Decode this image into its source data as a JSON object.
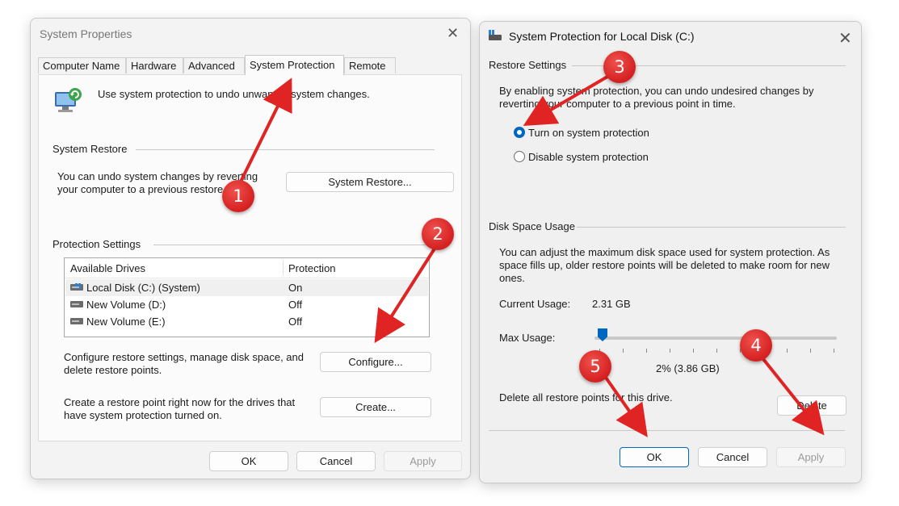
{
  "sysprops": {
    "title": "System Properties",
    "tabs": [
      "Computer Name",
      "Hardware",
      "Advanced",
      "System Protection",
      "Remote"
    ],
    "active_tab": "System Protection",
    "intro_text": "Use system protection to undo unwanted system changes.",
    "restore_group": "System Restore",
    "restore_desc_line1": "You can undo system changes by reverting",
    "restore_desc_line2": "your computer to a previous restore point.",
    "restore_button": "System Restore...",
    "protection_group": "Protection Settings",
    "drives_headers": {
      "drive": "Available Drives",
      "protection": "Protection"
    },
    "drives": [
      {
        "name": "Local Disk (C:) (System)",
        "protection": "On",
        "system": true
      },
      {
        "name": "New Volume (D:)",
        "protection": "Off",
        "system": false
      },
      {
        "name": "New Volume (E:)",
        "protection": "Off",
        "system": false
      }
    ],
    "configure_desc_line1": "Configure restore settings, manage disk space, and",
    "configure_desc_line2": "delete restore points.",
    "configure_button": "Configure...",
    "create_desc_line1": "Create a restore point right now for the drives that",
    "create_desc_line2": "have system protection turned on.",
    "create_button": "Create...",
    "ok": "OK",
    "cancel": "Cancel",
    "apply": "Apply"
  },
  "protdialog": {
    "title": "System Protection for Local Disk (C:)",
    "restore_group": "Restore Settings",
    "restore_desc_line1": "By enabling system protection, you can undo undesired changes by",
    "restore_desc_line2": "reverting your computer to a previous point in time.",
    "radio_on": "Turn on system protection",
    "radio_off": "Disable system protection",
    "radio_selected": "on",
    "disk_group": "Disk Space Usage",
    "disk_desc_line1": "You can adjust the maximum disk space used for system protection. As",
    "disk_desc_line2": "space fills up, older restore points will be deleted to make room for new",
    "disk_desc_line3": "ones.",
    "current_usage_label": "Current Usage:",
    "current_usage_value": "2.31 GB",
    "max_usage_label": "Max Usage:",
    "max_usage_value": "2% (3.86 GB)",
    "max_usage_percent": 2,
    "delete_desc": "Delete all restore points for this drive.",
    "delete_button": "Delete",
    "ok": "OK",
    "cancel": "Cancel",
    "apply": "Apply"
  },
  "annotations": [
    "1",
    "2",
    "3",
    "4",
    "5"
  ],
  "colors": {
    "accent": "#0067c0",
    "annotation": "#e02424"
  }
}
